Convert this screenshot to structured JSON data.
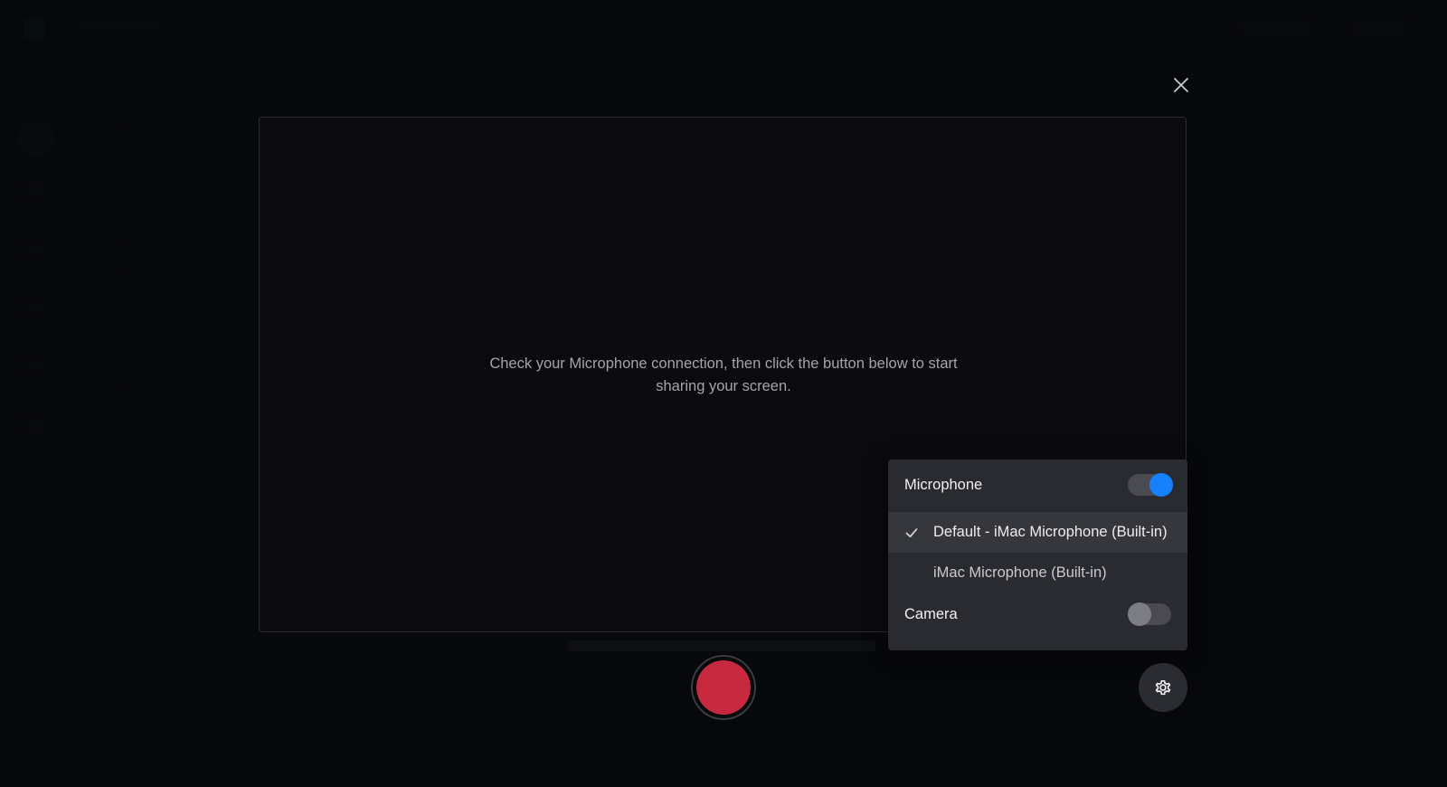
{
  "modal": {
    "instructions": "Check your Microphone connection, then click the button below to start sharing your screen."
  },
  "device_menu": {
    "microphone_label": "Microphone",
    "microphone_enabled": true,
    "microphone_options": [
      {
        "label": "Default - iMac Microphone (Built-in)",
        "selected": true
      },
      {
        "label": "iMac Microphone (Built-in)",
        "selected": false
      }
    ],
    "camera_label": "Camera",
    "camera_enabled": false
  },
  "icons": {
    "close": "close-icon",
    "check": "check-icon",
    "settings": "gear-icon",
    "record": "record-icon"
  },
  "colors": {
    "accent": "#1482ff",
    "record": "#c8283e",
    "popover_bg": "#2a2b30",
    "backdrop": "#0c0d10"
  }
}
